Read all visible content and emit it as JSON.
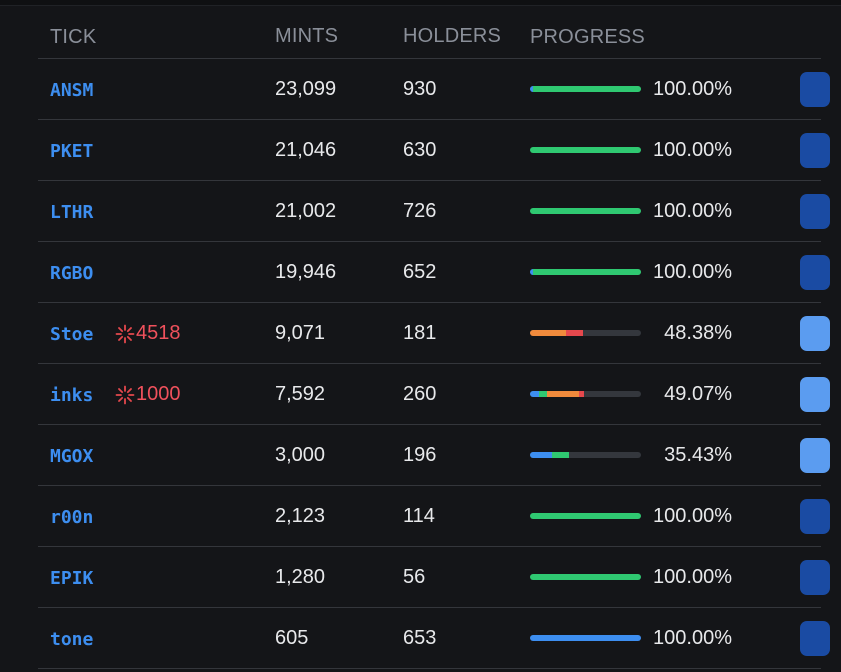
{
  "header": {
    "tick": "TICK",
    "mints": "MINTS",
    "holders": "HOLDERS",
    "progress": "PROGRESS"
  },
  "colors": {
    "green": "#2fc871",
    "blue": "#3d8ef0",
    "orange": "#f08a3c",
    "red": "#e5484d",
    "track": "#34373d",
    "button_dark": "#1a4ba3",
    "button_light": "#5b9cf0"
  },
  "rows": [
    {
      "tick": "ANSM",
      "badge": "",
      "mints": "23,099",
      "holders": "930",
      "percent": "100.00%",
      "segments": [
        {
          "color": "#3d8ef0",
          "fraction": 0.03
        },
        {
          "color": "#2fc871",
          "fraction": 0.97
        }
      ],
      "button": "dark"
    },
    {
      "tick": "PKET",
      "badge": "",
      "mints": "21,046",
      "holders": "630",
      "percent": "100.00%",
      "segments": [
        {
          "color": "#2fc871",
          "fraction": 1.0
        }
      ],
      "button": "dark"
    },
    {
      "tick": "LTHR",
      "badge": "",
      "mints": "21,002",
      "holders": "726",
      "percent": "100.00%",
      "segments": [
        {
          "color": "#2fc871",
          "fraction": 1.0
        }
      ],
      "button": "dark"
    },
    {
      "tick": "RGBO",
      "badge": "",
      "mints": "19,946",
      "holders": "652",
      "percent": "100.00%",
      "segments": [
        {
          "color": "#3d8ef0",
          "fraction": 0.03
        },
        {
          "color": "#2fc871",
          "fraction": 0.97
        }
      ],
      "button": "dark"
    },
    {
      "tick": "Stoe",
      "badge": "4518",
      "mints": "9,071",
      "holders": "181",
      "percent": "48.38%",
      "segments": [
        {
          "color": "#f08a3c",
          "fraction": 0.32
        },
        {
          "color": "#e5484d",
          "fraction": 0.16
        }
      ],
      "button": "light"
    },
    {
      "tick": "inks",
      "badge": "1000",
      "mints": "7,592",
      "holders": "260",
      "percent": "49.07%",
      "segments": [
        {
          "color": "#3d8ef0",
          "fraction": 0.08
        },
        {
          "color": "#2fc871",
          "fraction": 0.07
        },
        {
          "color": "#f08a3c",
          "fraction": 0.29
        },
        {
          "color": "#e5484d",
          "fraction": 0.05
        }
      ],
      "button": "light"
    },
    {
      "tick": "MGOX",
      "badge": "",
      "mints": "3,000",
      "holders": "196",
      "percent": "35.43%",
      "segments": [
        {
          "color": "#3d8ef0",
          "fraction": 0.2
        },
        {
          "color": "#2fc871",
          "fraction": 0.15
        }
      ],
      "button": "light"
    },
    {
      "tick": "r00n",
      "badge": "",
      "mints": "2,123",
      "holders": "114",
      "percent": "100.00%",
      "segments": [
        {
          "color": "#2fc871",
          "fraction": 1.0
        }
      ],
      "button": "dark"
    },
    {
      "tick": "EPIK",
      "badge": "",
      "mints": "1,280",
      "holders": "56",
      "percent": "100.00%",
      "segments": [
        {
          "color": "#2fc871",
          "fraction": 1.0
        }
      ],
      "button": "dark"
    },
    {
      "tick": "tone",
      "badge": "",
      "mints": "605",
      "holders": "653",
      "percent": "100.00%",
      "segments": [
        {
          "color": "#3d8ef0",
          "fraction": 1.0
        }
      ],
      "button": "dark"
    }
  ]
}
